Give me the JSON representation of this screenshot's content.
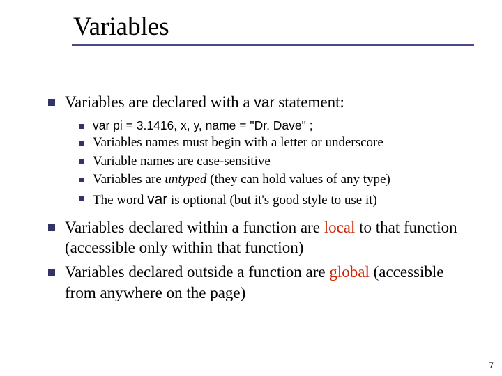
{
  "title": "Variables",
  "bullets": {
    "b1_pre": "Variables are declared with a ",
    "b1_code": "var",
    "b1_post": " statement:",
    "sub1": "var pi = 3.1416, x, y, name = \"Dr. Dave\" ;",
    "sub2": "Variables names must begin with a letter or underscore",
    "sub3": " Variable names are case-sensitive",
    "sub4_pre": "Variables are ",
    "sub4_ital": "untyped",
    "sub4_post": " (they can hold values of any type)",
    "sub5_pre": "The word ",
    "sub5_code": "var",
    "sub5_post": " is optional (but it's good style to use it)",
    "b2_pre": "Variables declared within a function are ",
    "b2_red": "local",
    "b2_post": " to that function (accessible only within that function)",
    "b3_pre": "Variables declared outside a function are ",
    "b3_red": "global",
    "b3_post": " (accessible from anywhere on the page)"
  },
  "page_number": "7"
}
